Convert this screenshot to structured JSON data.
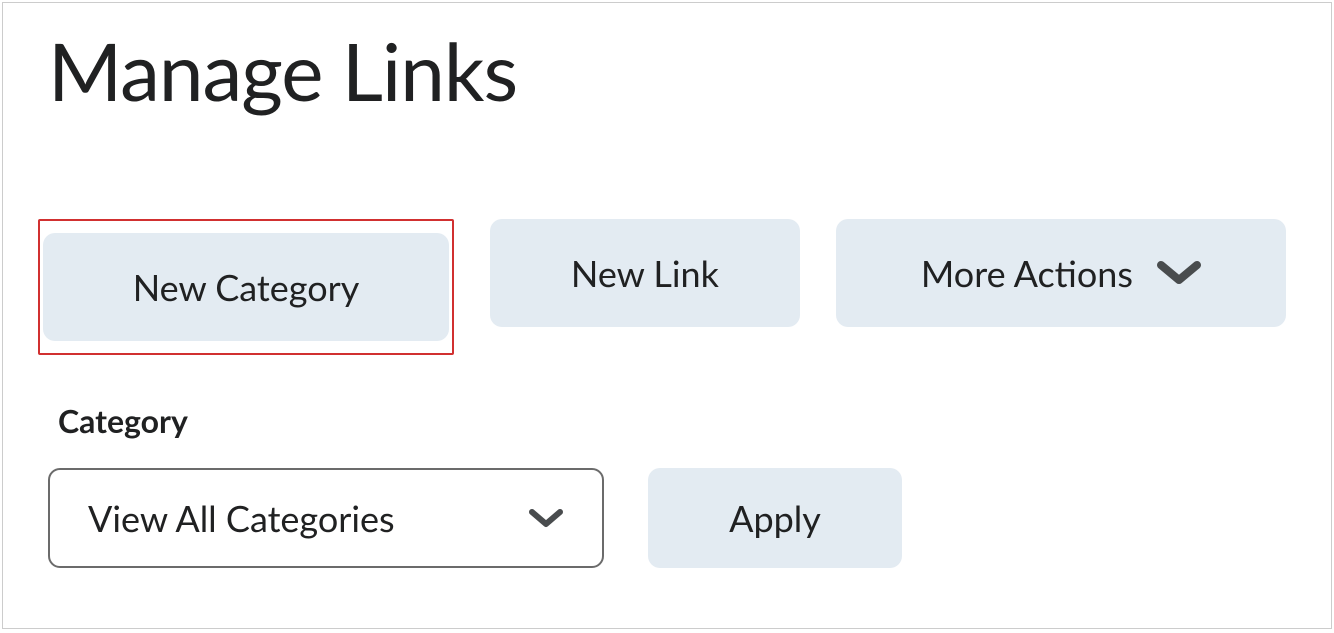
{
  "page": {
    "title": "Manage Links"
  },
  "toolbar": {
    "new_category_label": "New Category",
    "new_link_label": "New Link",
    "more_actions_label": "More Actions"
  },
  "filter": {
    "label": "Category",
    "selected": "View All Categories",
    "apply_label": "Apply"
  },
  "icons": {
    "chevron_down": "chevron-down"
  },
  "colors": {
    "button_bg": "#e3ebf2",
    "highlight_border": "#d13030",
    "text": "#202122",
    "select_border": "#6b6b6b"
  }
}
